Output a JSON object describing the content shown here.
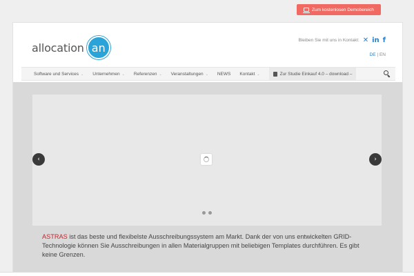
{
  "topbar": {
    "demo_button_label": "Zum kostenlosen Demobereich",
    "demo_button_color": "#f06a63"
  },
  "header": {
    "logo_text": "allocation",
    "logo_mark": "an",
    "contact_text": "Bleiben Sie mit uns in Kontakt:",
    "social": [
      {
        "name": "xing-icon",
        "glyph": "✕"
      },
      {
        "name": "linkedin-icon",
        "glyph": "in"
      },
      {
        "name": "facebook-icon",
        "glyph": "f"
      }
    ],
    "languages": {
      "de": "DE",
      "separator": "|",
      "en": "EN"
    }
  },
  "nav": {
    "items": [
      {
        "label": "Software und Services"
      },
      {
        "label": "Unternehmen"
      },
      {
        "label": "Referenzen"
      },
      {
        "label": "Veranstaltungen"
      },
      {
        "label": "NEWS"
      },
      {
        "label": "Kontakt"
      }
    ],
    "study_label": "Zur Studie Einkauf 4.0 – download –"
  },
  "slider": {
    "prev_glyph": "‹",
    "next_glyph": "›",
    "slide_count": 2
  },
  "intro": {
    "brand": "ASTRAS",
    "text": " ist das beste und flexibelste Ausschreibungssystem am Markt. Dank der von uns entwickelten GRID-Technologie können Sie Ausschreibungen in allen Materialgruppen mit beliebigen Templates durchführen. Es gibt keine Grenzen."
  },
  "colors": {
    "accent_blue": "#2aa3d8",
    "brand_red": "#c0272d"
  }
}
